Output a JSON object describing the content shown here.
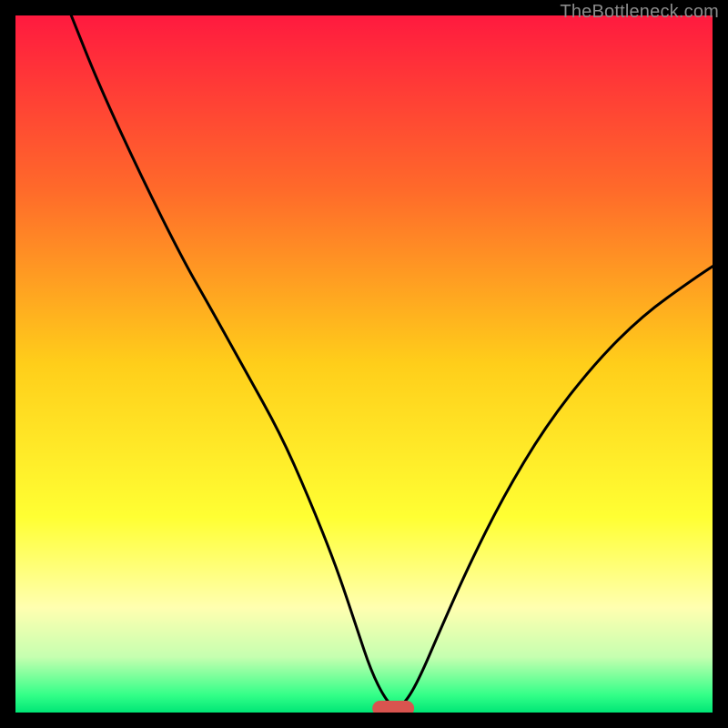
{
  "watermark": "TheBottleneck.com",
  "chart_data": {
    "type": "line",
    "title": "",
    "xlabel": "",
    "ylabel": "",
    "xlim": [
      0,
      100
    ],
    "ylim": [
      0,
      100
    ],
    "grid": false,
    "legend": false,
    "background_gradient": {
      "stops": [
        {
          "offset": 0.0,
          "color": "#ff1a3f"
        },
        {
          "offset": 0.25,
          "color": "#ff6a2a"
        },
        {
          "offset": 0.5,
          "color": "#ffce1a"
        },
        {
          "offset": 0.72,
          "color": "#ffff33"
        },
        {
          "offset": 0.85,
          "color": "#ffffb0"
        },
        {
          "offset": 0.92,
          "color": "#c6ffb0"
        },
        {
          "offset": 0.975,
          "color": "#33ff88"
        },
        {
          "offset": 1.0,
          "color": "#00e676"
        }
      ]
    },
    "series": [
      {
        "name": "bottleneck-curve",
        "color": "#000000",
        "x": [
          8,
          12,
          18,
          24,
          28,
          33,
          38,
          42,
          46,
          49,
          51,
          53,
          54.5,
          56,
          58,
          61,
          65,
          70,
          76,
          83,
          90,
          97,
          100
        ],
        "y": [
          100,
          90,
          77,
          65,
          58,
          49,
          40,
          31,
          21,
          12,
          6,
          2,
          0.5,
          1.5,
          5,
          12,
          21,
          31,
          41,
          50,
          57,
          62,
          64
        ]
      }
    ],
    "marker": {
      "name": "optimal-marker",
      "color": "#d9544f",
      "x_center": 54.2,
      "y_center": 0.6,
      "width": 6.0,
      "height": 2.2,
      "rx": 1.1
    }
  }
}
